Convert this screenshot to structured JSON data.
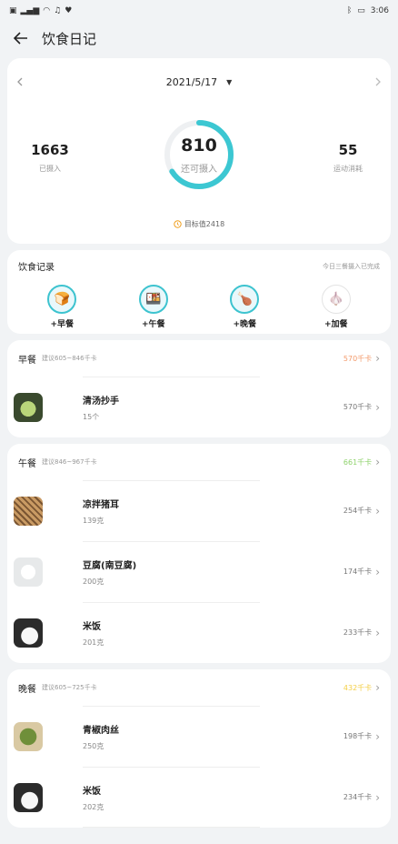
{
  "status": {
    "time": "3:06"
  },
  "header": {
    "title": "饮食日记"
  },
  "summary": {
    "date": "2021/5/17",
    "intake": "1663",
    "intake_label": "已摄入",
    "remaining": "810",
    "remaining_label": "还可摄入",
    "burned": "55",
    "burned_label": "运动消耗",
    "goal": "目标值2418",
    "ring_fill": 0.66,
    "ring_color": "#3cc7d2"
  },
  "records": {
    "title": "饮食记录",
    "subtitle": "今日三餐摄入已完成",
    "meals": [
      {
        "label": "+早餐",
        "icon": "bread-icon"
      },
      {
        "label": "+午餐",
        "icon": "lunchbox-icon"
      },
      {
        "label": "+晚餐",
        "icon": "drumstick-icon"
      },
      {
        "label": "+加餐",
        "icon": "garlic-icon"
      }
    ]
  },
  "breakfast": {
    "name": "早餐",
    "hint": "建议605~846千卡",
    "total": "570千卡",
    "total_color": "#f39a6b",
    "items": [
      {
        "name": "清汤抄手",
        "qty": "15个",
        "kcal": "570千卡"
      }
    ]
  },
  "lunch": {
    "name": "午餐",
    "hint": "建议846~967千卡",
    "total": "661千卡",
    "total_color": "#8fd26c",
    "items": [
      {
        "name": "凉拌猪耳",
        "qty": "139克",
        "kcal": "254千卡"
      },
      {
        "name": "豆腐(南豆腐)",
        "qty": "200克",
        "kcal": "174千卡"
      },
      {
        "name": "米饭",
        "qty": "201克",
        "kcal": "233千卡"
      }
    ]
  },
  "dinner": {
    "name": "晚餐",
    "hint": "建议605~725千卡",
    "total": "432千卡",
    "total_color": "#f4cf46",
    "items": [
      {
        "name": "青椒肉丝",
        "qty": "250克",
        "kcal": "198千卡"
      },
      {
        "name": "米饭",
        "qty": "202克",
        "kcal": "234千卡"
      }
    ]
  }
}
